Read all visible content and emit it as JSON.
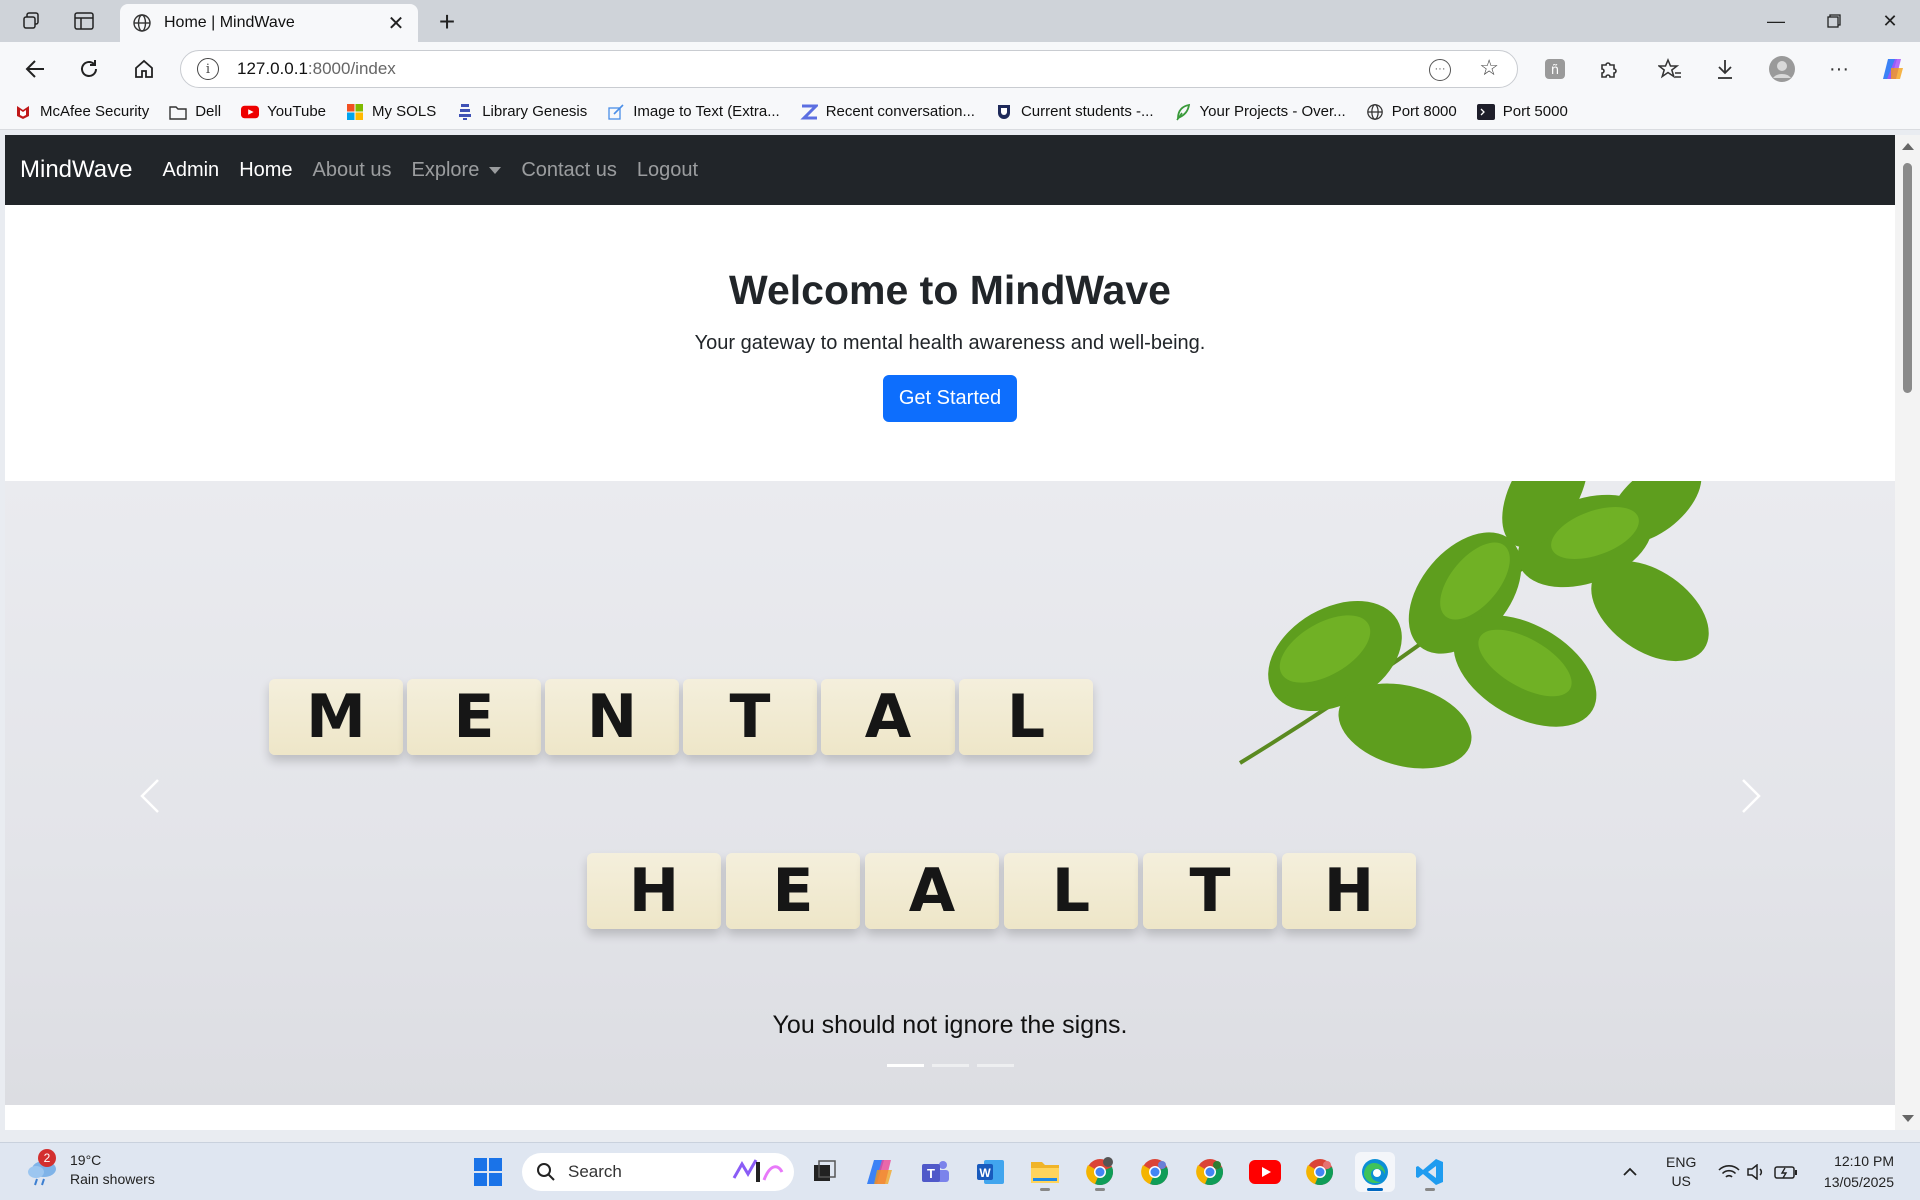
{
  "browser": {
    "tab_title": "Home | MindWave",
    "url_host": "127.0.0.1",
    "url_path": ":8000/index"
  },
  "bookmarks": [
    {
      "label": "McAfee Security",
      "icon": "mcafee-icon"
    },
    {
      "label": "Dell",
      "icon": "folder-icon"
    },
    {
      "label": "YouTube",
      "icon": "youtube-icon"
    },
    {
      "label": "My SOLS",
      "icon": "microsoft-icon"
    },
    {
      "label": "Library Genesis",
      "icon": "libgen-icon"
    },
    {
      "label": "Image to Text (Extra...",
      "icon": "edit-icon"
    },
    {
      "label": "Recent conversation...",
      "icon": "z-icon"
    },
    {
      "label": "Current students -...",
      "icon": "shield-crest-icon"
    },
    {
      "label": "Your Projects - Over...",
      "icon": "leaf-icon"
    },
    {
      "label": "Port 8000",
      "icon": "globe-icon"
    },
    {
      "label": "Port 5000",
      "icon": "terminal-icon"
    }
  ],
  "navbar": {
    "brand": "MindWave",
    "links": {
      "admin": "Admin",
      "home": "Home",
      "about": "About us",
      "explore": "Explore",
      "contact": "Contact us",
      "logout": "Logout"
    }
  },
  "hero": {
    "title": "Welcome to MindWave",
    "subtitle": "Your gateway to mental health awareness and well-being.",
    "cta": "Get Started"
  },
  "carousel": {
    "word1": [
      "M",
      "E",
      "N",
      "T",
      "A",
      "L"
    ],
    "word2": [
      "H",
      "E",
      "A",
      "L",
      "T",
      "H"
    ],
    "caption": "You should not ignore the signs.",
    "slide_count": 3,
    "active_slide": 1
  },
  "taskbar": {
    "weather_badge": "2",
    "temperature": "19°C",
    "weather_desc": "Rain showers",
    "search_placeholder": "Search",
    "lang_top": "ENG",
    "lang_bottom": "US",
    "time": "12:10 PM",
    "date": "13/05/2025"
  },
  "colors": {
    "navbar_bg": "#212529",
    "primary": "#0d6efd"
  }
}
